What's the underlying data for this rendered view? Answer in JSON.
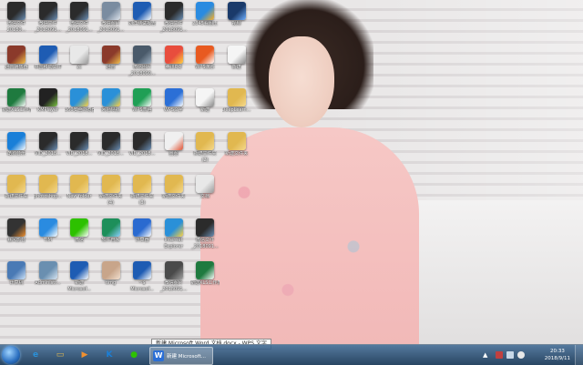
{
  "desktop": {
    "icons": [
      {
        "name": "video-icon",
        "label": "微信文件\n20180...",
        "color": "#2b2b2b",
        "accent": "#6b8fb5"
      },
      {
        "name": "winrar-icon",
        "label": "迅雷播放器",
        "color": "#8b3a2b",
        "accent": "#f2c14e"
      },
      {
        "name": "excel-icon",
        "label": "新建XLS工作表",
        "color": "#1f7a3f",
        "accent": "#ffffff"
      },
      {
        "name": "kugou-icon",
        "label": "酷狗音乐",
        "color": "#1a7fd8",
        "accent": "#ffffff"
      },
      {
        "name": "folder-icon",
        "label": "新建文件夹",
        "color": "#e1b850",
        "accent": "#f5d98c"
      },
      {
        "name": "media-icon",
        "label": "暴风影音",
        "color": "#333333",
        "accent": "#f09030"
      },
      {
        "name": "computer-icon",
        "label": "计算机",
        "color": "#4a7ab5",
        "accent": "#cfe3f7"
      },
      {
        "name": "video-icon",
        "label": "微信文件\n_2018091...",
        "color": "#2b2b2b",
        "accent": "#6b8fb5"
      },
      {
        "name": "word-icon",
        "label": "中国移动文件",
        "color": "#1e5cb3",
        "accent": "#ffffff"
      },
      {
        "name": "kmplayer-icon",
        "label": "KMPlayer",
        "color": "#222222",
        "accent": "#7ac143"
      },
      {
        "name": "video-icon",
        "label": "VID_2018...",
        "color": "#2b2b2b",
        "accent": "#6b8fb5"
      },
      {
        "name": "folder-icon",
        "label": "photoshop...",
        "color": "#e1b850",
        "accent": "#f5d98c"
      },
      {
        "name": "star-icon",
        "label": "TIM",
        "color": "#2a8be0",
        "accent": "#ffffff"
      },
      {
        "name": "recycle-icon",
        "label": "Administr...",
        "color": "#6a8fb0",
        "accent": "#d9e6f2"
      },
      {
        "name": "video-icon",
        "label": "微信文件\n_2018091...",
        "color": "#2b2b2b",
        "accent": "#6b8fb5"
      },
      {
        "name": "file-icon",
        "label": "zc",
        "color": "#e8e8e8",
        "accent": "#999999"
      },
      {
        "name": "ie-icon",
        "label": "360安全浏览器",
        "color": "#2a90d8",
        "accent": "#ffd23f"
      },
      {
        "name": "video-icon",
        "label": "VID_2018...",
        "color": "#2b2b2b",
        "accent": "#6b8fb5"
      },
      {
        "name": "folder-icon",
        "label": "New folder",
        "color": "#e1b850",
        "accent": "#f5d98c"
      },
      {
        "name": "wechat-icon",
        "label": "微信",
        "color": "#2dc100",
        "accent": "#ffffff"
      },
      {
        "name": "word-icon",
        "label": "新建\nMicrosof...",
        "color": "#1e5cb3",
        "accent": "#ffffff"
      },
      {
        "name": "image-icon",
        "label": "微信图片\n_2018091...",
        "color": "#7a8ca0",
        "accent": "#e0e6ee"
      },
      {
        "name": "winrar-icon",
        "label": "迅雷",
        "color": "#8b3a2b",
        "accent": "#f2c14e"
      },
      {
        "name": "ie-icon",
        "label": "网址导航",
        "color": "#2a90d8",
        "accent": "#ffd23f"
      },
      {
        "name": "video-icon",
        "label": "VID_2018...",
        "color": "#2b2b2b",
        "accent": "#6b8fb5"
      },
      {
        "name": "folder-icon",
        "label": "新建文件夹\n(4)",
        "color": "#e1b850",
        "accent": "#f5d98c"
      },
      {
        "name": "globe-icon",
        "label": "软件管家",
        "color": "#1d8f5a",
        "accent": "#8fd0ff"
      },
      {
        "name": "image-icon",
        "label": "timg",
        "color": "#c8a58a",
        "accent": "#f2e0d0"
      },
      {
        "name": "word-icon",
        "label": "刘洋测试报告",
        "color": "#1e5cb3",
        "accent": "#ffffff"
      },
      {
        "name": "image-icon",
        "label": "微信图片\n_2018090...",
        "color": "#4a5a6a",
        "accent": "#9fb0c0"
      },
      {
        "name": "wps-icon",
        "label": "WPS表格",
        "color": "#1f9f55",
        "accent": "#ffffff"
      },
      {
        "name": "video-icon",
        "label": "VID_2018...",
        "color": "#2b2b2b",
        "accent": "#6b8fb5"
      },
      {
        "name": "folder-icon",
        "label": "新建文件夹\n(3)",
        "color": "#e1b850",
        "accent": "#f5d98c"
      },
      {
        "name": "calc-icon",
        "label": "计算器",
        "color": "#2a6ad0",
        "accent": "#ffffff"
      },
      {
        "name": "word-icon",
        "label": "~$\nMicrosof...",
        "color": "#1e5cb3",
        "accent": "#ffffff"
      },
      {
        "name": "video-icon",
        "label": "微信文件\n_2018091...",
        "color": "#2b2b2b",
        "accent": "#6b8fb5"
      },
      {
        "name": "app-icon",
        "label": "腾讯QQ",
        "color": "#e84d3d",
        "accent": "#ffd23f"
      },
      {
        "name": "wps-icon",
        "label": "WPS文字",
        "color": "#2b6fd6",
        "accent": "#ffffff"
      },
      {
        "name": "paint-icon",
        "label": "画图",
        "color": "#f0f0f0",
        "accent": "#e05030"
      },
      {
        "name": "folder-icon",
        "label": "新建文件夹",
        "color": "#e1b850",
        "accent": "#f5d98c"
      },
      {
        "name": "ie-icon",
        "label": "Internet\nExplorer",
        "color": "#2a90d8",
        "accent": "#ffd23f"
      },
      {
        "name": "image-icon",
        "label": "微信图片\n_2018091...",
        "color": "#4a4a4a",
        "accent": "#a0a0a0"
      },
      {
        "name": "browser-icon",
        "label": "2345看图王",
        "color": "#2a8be0",
        "accent": "#ffb020"
      },
      {
        "name": "wps-icon",
        "label": "WPS演示",
        "color": "#e85a20",
        "accent": "#ffffff"
      },
      {
        "name": "doc-icon",
        "label": "新建",
        "color": "#f5f5f5",
        "accent": "#888888"
      },
      {
        "name": "folder-icon",
        "label": "新建文件夹\n(2)",
        "color": "#e1b850",
        "accent": "#f5d98c"
      },
      {
        "name": "file-icon",
        "label": "文档",
        "color": "#e8e8e8",
        "accent": "#999999"
      },
      {
        "name": "video-icon",
        "label": "微信文件\n_2018091...",
        "color": "#2b2b2b",
        "accent": "#6b8fb5"
      },
      {
        "name": "excel-icon",
        "label": "新建XLS工作表",
        "color": "#1f7a3f",
        "accent": "#ffffff"
      },
      {
        "name": "movie-icon",
        "label": "视频",
        "color": "#1a3a6a",
        "accent": "#6fb0ff"
      },
      {
        "name": "doc-icon",
        "label": "新建",
        "color": "#f5f5f5",
        "accent": "#888888"
      },
      {
        "name": "folder-icon",
        "label": "DeepLearn...",
        "color": "#e1b850",
        "accent": "#f5d98c"
      },
      {
        "name": "folder-icon",
        "label": "新建文件夹",
        "color": "#e1b850",
        "accent": "#f5d98c"
      }
    ]
  },
  "tooltip": {
    "text": "新建 Microsoft Word 文档.docx - WPS 文字"
  },
  "taskbar": {
    "pinned": [
      {
        "name": "ie-taskbar-icon",
        "glyph": "e",
        "color": "#2a90d8"
      },
      {
        "name": "explorer-taskbar-icon",
        "glyph": "▭",
        "color": "#e1b850"
      },
      {
        "name": "media-player-taskbar-icon",
        "glyph": "▶",
        "color": "#f09030"
      },
      {
        "name": "kugou-taskbar-icon",
        "glyph": "K",
        "color": "#1a7fd8"
      },
      {
        "name": "360-browser-taskbar-icon",
        "glyph": "●",
        "color": "#2dc100"
      }
    ],
    "active_task": {
      "glyph": "W",
      "label": "新建 Microsoft..."
    },
    "clock": {
      "time": "20:33",
      "date": "2018/9/11"
    }
  }
}
